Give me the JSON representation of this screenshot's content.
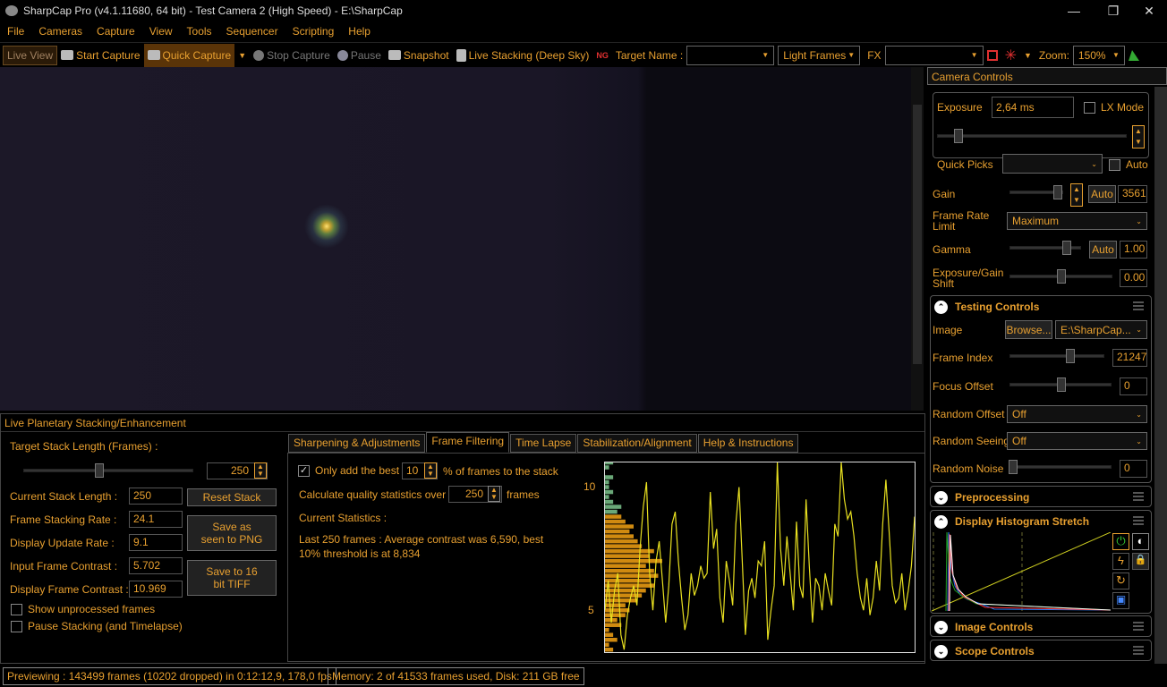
{
  "window": {
    "title": "SharpCap Pro (v4.1.11680, 64 bit) - Test Camera 2 (High Speed) - E:\\SharpCap",
    "minimize": "—",
    "maximize": "❐",
    "close": "✕"
  },
  "menu": [
    "File",
    "Cameras",
    "Capture",
    "View",
    "Tools",
    "Sequencer",
    "Scripting",
    "Help"
  ],
  "toolbar": {
    "live_view": "Live View",
    "start_capture": "Start Capture",
    "quick_capture": "Quick Capture",
    "stop_capture": "Stop Capture",
    "pause": "Pause",
    "snapshot": "Snapshot",
    "live_stacking": "Live Stacking (Deep Sky)",
    "target_name_label": "Target Name :",
    "target_name_value": "",
    "frame_type": "Light Frames",
    "fx_label": "FX",
    "fx_value": "",
    "zoom_label": "Zoom:",
    "zoom_value": "150%"
  },
  "stacking": {
    "title": "Live Planetary Stacking/Enhancement",
    "target_length_label": "Target Stack Length (Frames) :",
    "target_length": "250",
    "target_slider_fraction": 0.44,
    "current_length_label": "Current Stack Length :",
    "current_length": "250",
    "stack_rate_label": "Frame Stacking Rate :",
    "stack_rate": "24.1",
    "update_rate_label": "Display Update Rate :",
    "update_rate": "9.1",
    "input_contrast_label": "Input Frame Contrast :",
    "input_contrast": "5.702",
    "display_contrast_label": "Display Frame Contrast :",
    "display_contrast": "10.969",
    "reset_button": "Reset Stack",
    "save_png_button": "Save as seen to PNG",
    "save_tiff_button": "Save to 16 bit TIFF",
    "show_unprocessed": "Show unprocessed frames",
    "pause_stacking": "Pause Stacking (and Timelapse)",
    "tabs": [
      "Sharpening & Adjustments",
      "Frame Filtering",
      "Time Lapse",
      "Stabilization/Alignment",
      "Help & Instructions"
    ],
    "active_tab": 1,
    "only_best_label": "Only add the best",
    "only_best_checked": true,
    "best_percent": "10",
    "best_suffix": "% of frames to the stack",
    "calc_label": "Calculate quality statistics over",
    "calc_frames": "250",
    "calc_suffix": "frames",
    "current_stats_label": "Current Statistics :",
    "stats_text": "Last 250 frames : Average contrast was 6,590, best 10% threshold is at 8,834"
  },
  "chart_data": {
    "type": "line",
    "ylim": [
      3.3,
      11
    ],
    "yticks": [
      "10",
      "5"
    ],
    "yticks_values": [
      10,
      5
    ],
    "threshold": 8.834,
    "line_color": "#e8e020",
    "values": [
      5.0,
      6.2,
      4.5,
      5.8,
      6.5,
      4.0,
      3.4,
      4.8,
      5.5,
      6.0,
      5.2,
      7.5,
      9.2,
      10.2,
      6.5,
      5.0,
      7.0,
      7.8,
      6.2,
      4.5,
      6.0,
      8.5,
      9.0,
      7.0,
      5.5,
      4.2,
      4.8,
      6.5,
      5.6,
      6.0,
      6.8,
      6.3,
      6.5,
      9.8,
      7.5,
      8.3,
      5.5,
      4.5,
      7.0,
      6.2,
      5.2,
      8.5,
      10.0,
      7.0,
      4.0,
      5.8,
      6.3,
      5.5,
      7.0,
      6.8,
      7.8,
      3.8,
      5.0,
      6.0,
      11.0,
      7.5,
      6.0,
      8.0,
      6.5,
      5.0,
      8.6,
      6.0,
      5.5,
      9.5,
      6.8,
      4.5,
      6.3,
      6.0,
      5.0,
      6.5,
      5.8,
      5.2,
      8.5,
      8.0,
      11.0,
      9.5,
      8.7,
      9.0,
      8.0,
      6.5,
      5.5,
      5.0,
      6.3,
      4.8,
      5.5,
      7.0,
      5.8,
      8.5,
      10.3,
      8.2,
      6.0,
      5.3,
      5.5,
      6.5,
      5.0,
      5.8,
      6.8,
      8.8
    ],
    "histogram": {
      "bin_start": 3.3,
      "bin_width": 0.2,
      "counts": [
        2,
        1,
        3,
        2,
        1,
        4,
        3,
        5,
        6,
        5,
        8,
        9,
        10,
        12,
        11,
        13,
        12,
        10,
        14,
        11,
        12,
        9,
        8,
        7,
        6,
        7,
        5,
        4,
        3,
        4,
        2,
        1,
        2,
        1,
        1,
        2,
        0,
        1,
        2
      ],
      "below_color": "#d08a10",
      "above_color": "#6aa878"
    }
  },
  "camera_controls": {
    "title": "Camera Controls",
    "exposure_label": "Exposure",
    "exposure": "2,64 ms",
    "lx_mode": "LX Mode",
    "quick_picks_label": "Quick Picks",
    "quick_picks": "",
    "auto_label": "Auto",
    "gain_label": "Gain",
    "gain_auto": "Auto",
    "gain": "3561",
    "frame_rate_label": "Frame Rate Limit",
    "frame_rate": "Maximum",
    "gamma_label": "Gamma",
    "gamma_auto": "Auto",
    "gamma": "1.00",
    "shift_label": "Exposure/Gain Shift",
    "shift": "0.00"
  },
  "testing_controls": {
    "title": "Testing Controls",
    "image_label": "Image",
    "browse": "Browse...",
    "image_path": "E:\\SharpCap...",
    "frame_index_label": "Frame Index",
    "frame_index": "21247",
    "focus_offset_label": "Focus Offset",
    "focus_offset": "0",
    "random_offset_label": "Random Offset",
    "random_offset": "Off",
    "random_seeing_label": "Random Seeing",
    "random_seeing": "Off",
    "random_noise_label": "Random Noise",
    "random_noise": "0"
  },
  "sections": {
    "preprocessing": "Preprocessing",
    "histogram": "Display Histogram Stretch",
    "image_controls": "Image Controls",
    "scope_controls": "Scope Controls"
  },
  "status": {
    "preview": "Previewing : 143499 frames (10202 dropped) in 0:12:12,9, 178,0 fps",
    "memory": "Memory: 2 of 41533 frames used, Disk: 211 GB free"
  },
  "colors": {
    "accent": "#e8a030",
    "background": "#000000"
  }
}
